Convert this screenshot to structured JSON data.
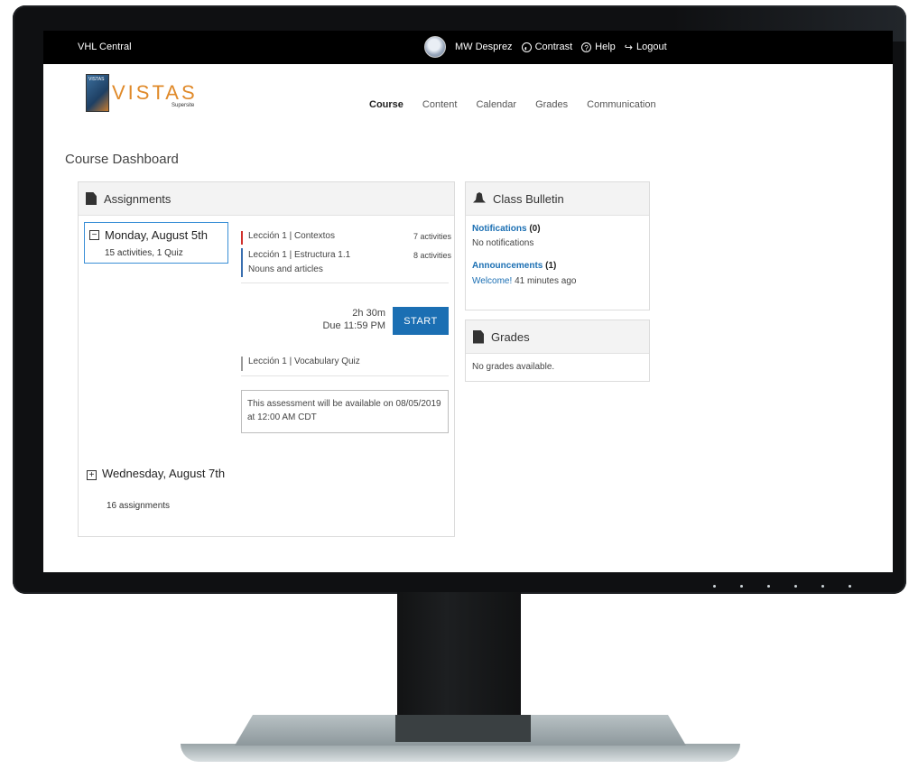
{
  "topbar": {
    "brand": "VHL Central",
    "user": "MW Desprez",
    "contrast": "Contrast",
    "help": "Help",
    "logout": "Logout"
  },
  "logo": {
    "text": "VISTAS",
    "sub": "Supersite",
    "book_title": "VISTAS"
  },
  "nav": {
    "items": [
      "Course",
      "Content",
      "Calendar",
      "Grades",
      "Communication"
    ],
    "active": "Course"
  },
  "page_title": "Course Dashboard",
  "assignments": {
    "header": "Assignments",
    "day1": {
      "toggle": "−",
      "title": "Monday, August 5th",
      "sub": "15 activities, 1 Quiz"
    },
    "lessons": [
      {
        "label": "Lección 1 | Contextos",
        "count": "7 activities"
      },
      {
        "label": "Lección 1 | Estructura 1.1",
        "label2": "Nouns and articles",
        "count": "8 activities"
      }
    ],
    "time": "2h 30m",
    "due": "Due 11:59 PM",
    "start": "START",
    "quiz": "Lección 1 | Vocabulary Quiz",
    "note": "This assessment will be available on 08/05/2019 at 12:00 AM CDT",
    "day2": {
      "toggle": "+",
      "title": "Wednesday, August 7th",
      "sub": "16 assignments"
    }
  },
  "bulletin": {
    "header": "Class Bulletin",
    "notifications_label": "Notifications",
    "notifications_count": "(0)",
    "notifications_text": "No notifications",
    "announcements_label": "Announcements",
    "announcements_count": "(1)",
    "welcome": "Welcome!",
    "welcome_time": "41 minutes ago"
  },
  "grades_panel": {
    "header": "Grades",
    "text": "No grades available."
  },
  "colors": {
    "accent": "#1b6fb3",
    "topbar": "#000000",
    "logo": "#e08a2a",
    "toggle_on": "#5fb33a"
  }
}
